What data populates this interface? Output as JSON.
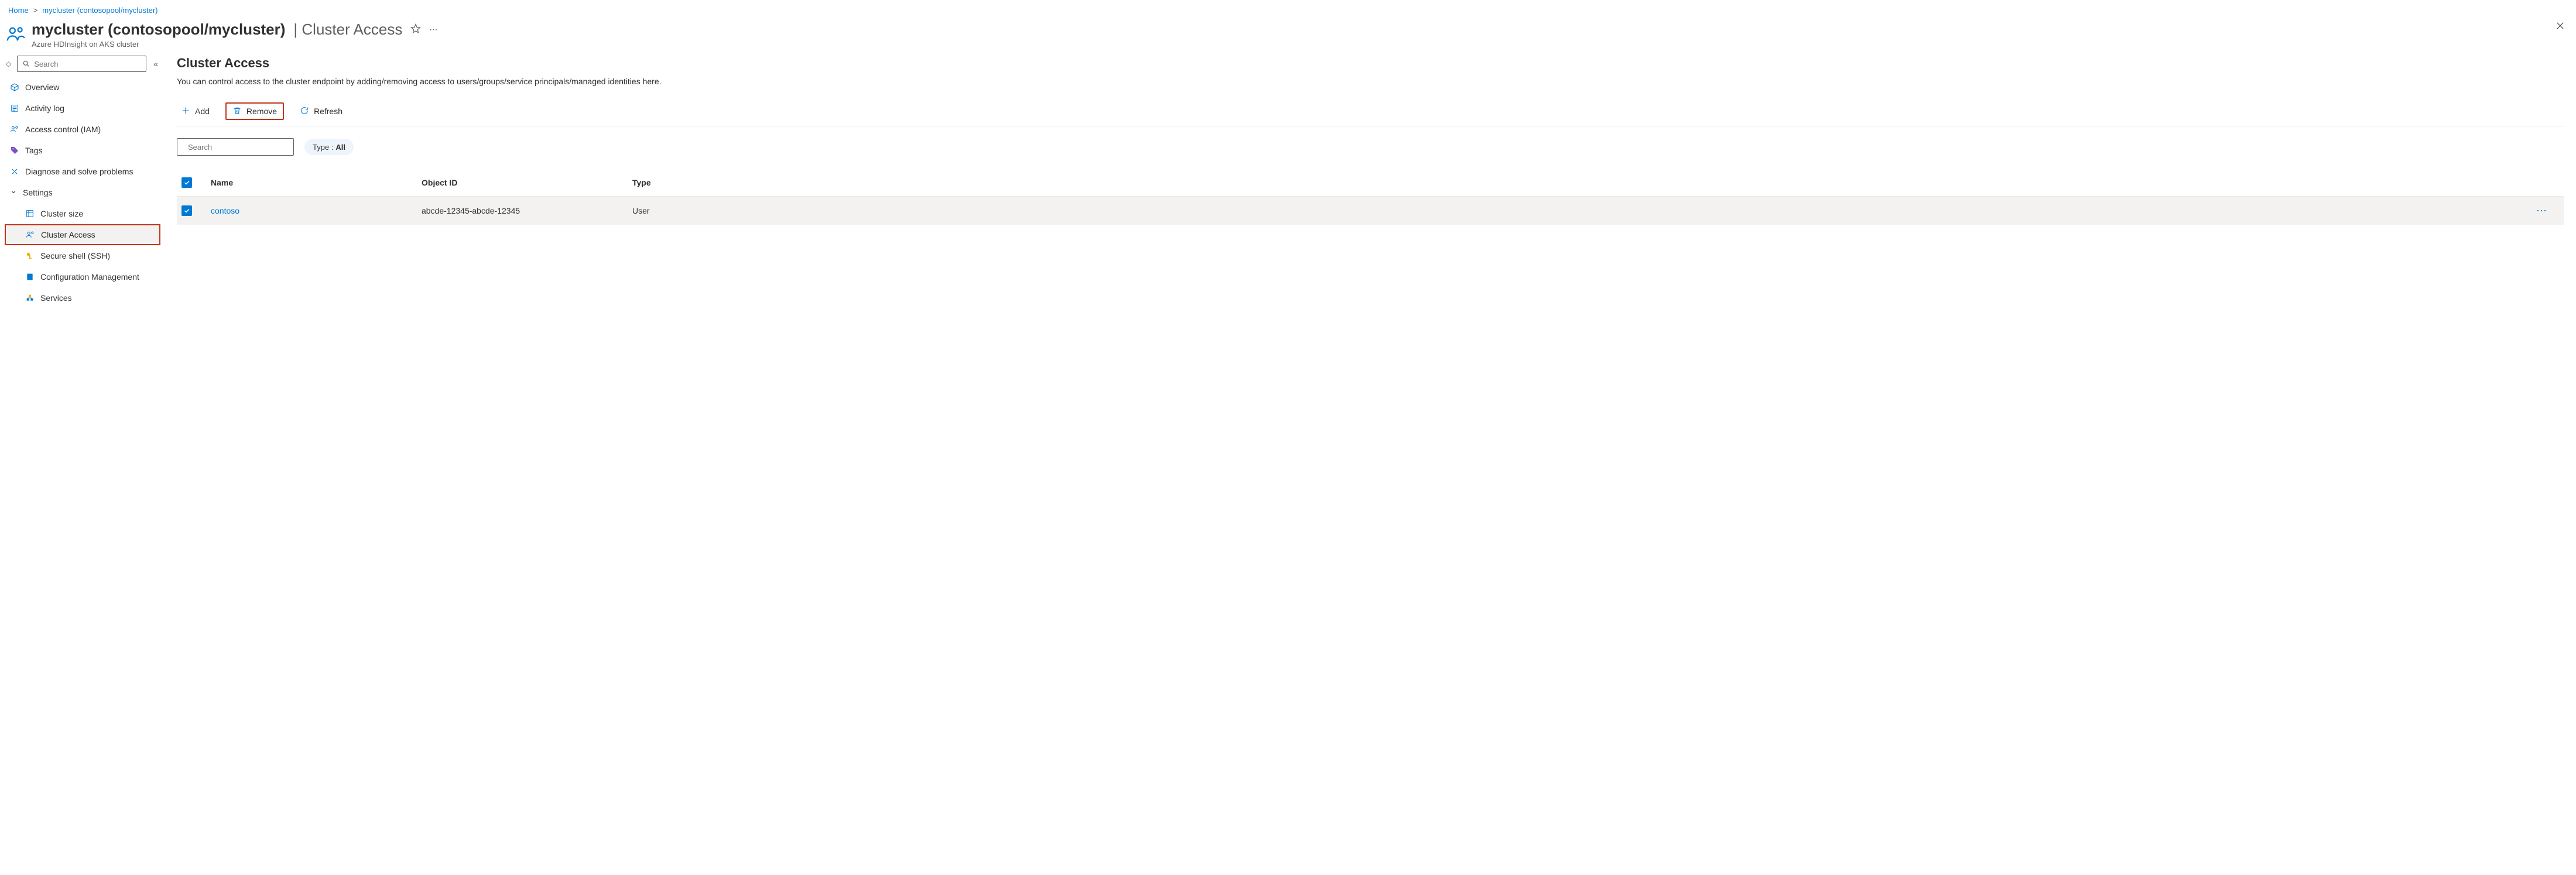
{
  "breadcrumb": {
    "home": "Home",
    "current": "mycluster (contosopool/mycluster)"
  },
  "header": {
    "title_main": "mycluster (contosopool/mycluster)",
    "title_suffix": "| Cluster Access",
    "subtitle": "Azure HDInsight on AKS cluster"
  },
  "sidebar": {
    "search_placeholder": "Search",
    "items": {
      "overview": "Overview",
      "activity_log": "Activity log",
      "access_control": "Access control (IAM)",
      "tags": "Tags",
      "diagnose": "Diagnose and solve problems",
      "settings_group": "Settings",
      "cluster_size": "Cluster size",
      "cluster_access": "Cluster Access",
      "secure_shell": "Secure shell (SSH)",
      "config_mgmt": "Configuration Management",
      "services": "Services"
    }
  },
  "main": {
    "title": "Cluster Access",
    "description": "You can control access to the cluster endpoint by adding/removing access to users/groups/service principals/managed identities here.",
    "toolbar": {
      "add": "Add",
      "remove": "Remove",
      "refresh": "Refresh"
    },
    "filters": {
      "search_placeholder": "Search",
      "type_label": "Type :",
      "type_value": "All"
    },
    "table": {
      "columns": {
        "name": "Name",
        "object_id": "Object ID",
        "type": "Type"
      },
      "rows": [
        {
          "name": "contoso",
          "object_id": "abcde-12345-abcde-12345",
          "type": "User"
        }
      ]
    }
  }
}
